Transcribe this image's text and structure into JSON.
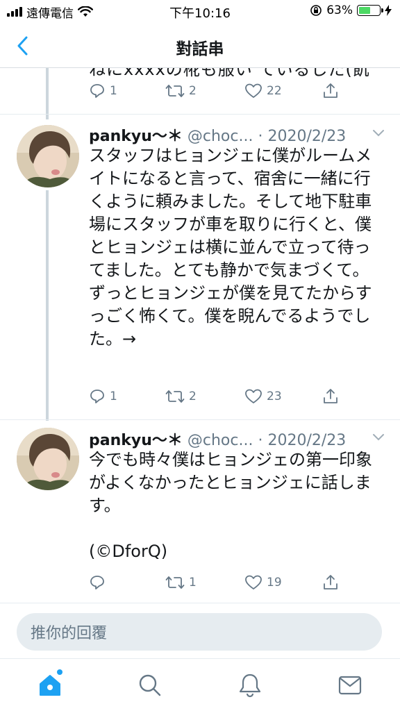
{
  "status_bar": {
    "carrier": "遠傳電信",
    "time": "下午10:16",
    "battery_percent": "63%",
    "battery_level": 0.63
  },
  "nav": {
    "title": "對話串",
    "back_icon": "chevron-left-icon"
  },
  "previous_tweet": {
    "cutoff_text": "ねにxxxxの椛も服い ているした(飢",
    "replies": "1",
    "retweets": "2",
    "likes": "22"
  },
  "tweets": [
    {
      "name": "pankyu～＊",
      "handle": "@choc...",
      "date": "· 2020/2/23",
      "text": "スタッフはヒョンジェに僕がルームメイトになると言って、宿舍に一緒に行くように頼みました。そして地下駐車場にスタッフが車を取りに行くと、僕とヒョンジェは横に並んで立って待ってました。とても静かで気まづくて。ずっとヒョンジェが僕を見てたからすっごく怖くて。僕を睨んでるようでした。→",
      "replies": "1",
      "retweets": "2",
      "likes": "23"
    },
    {
      "name": "pankyu～＊",
      "handle": "@choc...",
      "date": "· 2020/2/23",
      "text": "今でも時々僕はヒョンジェの第一印象がよくなかったとヒョンジェに話します。\n\n(©DforQ)",
      "replies": "",
      "retweets": "1",
      "likes": "19"
    }
  ],
  "reply": {
    "placeholder": "推你的回覆"
  },
  "tab_bar": {
    "items": [
      "home-icon",
      "search-icon",
      "notifications-icon",
      "messages-icon"
    ]
  },
  "colors": {
    "accent": "#1da1f2",
    "meta_text": "#657786",
    "thread_line": "#ccd6dd",
    "battery_fill": "#4cd964"
  }
}
